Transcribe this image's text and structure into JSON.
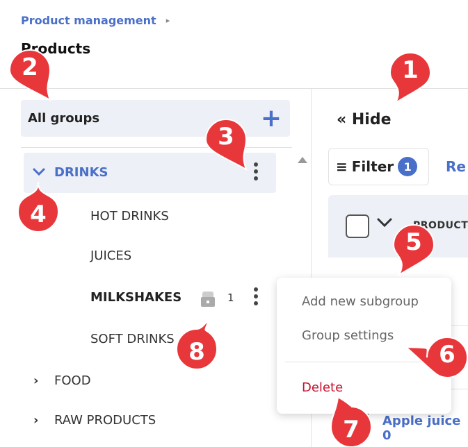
{
  "breadcrumb": {
    "label": "Product management",
    "chevron": "▸"
  },
  "page_title": "Products",
  "sidebar": {
    "all_groups_label": "All groups",
    "add_icon": "+",
    "tree": {
      "drinks": {
        "label": "DRINKS",
        "expanded_chevron": "⌄"
      },
      "subgroups": [
        "HOT DRINKS",
        "JUICES",
        "MILKSHAKES",
        "SOFT DRINKS"
      ],
      "milkshakes_count": "1",
      "top_level": [
        "FOOD",
        "RAW PRODUCTS"
      ],
      "collapsed_chevron": "›"
    }
  },
  "main": {
    "hide_label": "« Hide",
    "filter": {
      "label": "Filter",
      "icon": "≡",
      "badge": "1"
    },
    "reset_link_partial": "Re",
    "table": {
      "product_header_partial": "PRODUCT",
      "row_partial": "Apple juice 0"
    }
  },
  "context_menu": {
    "items": [
      "Add new subgroup",
      "Group settings"
    ],
    "delete_label": "Delete"
  },
  "callouts": [
    "1",
    "2",
    "3",
    "4",
    "5",
    "6",
    "7",
    "8"
  ],
  "colors": {
    "accent": "#4a6fc8",
    "danger": "#c8102e",
    "callout": "#e8373b",
    "highlight_bg": "#edf0f6"
  }
}
